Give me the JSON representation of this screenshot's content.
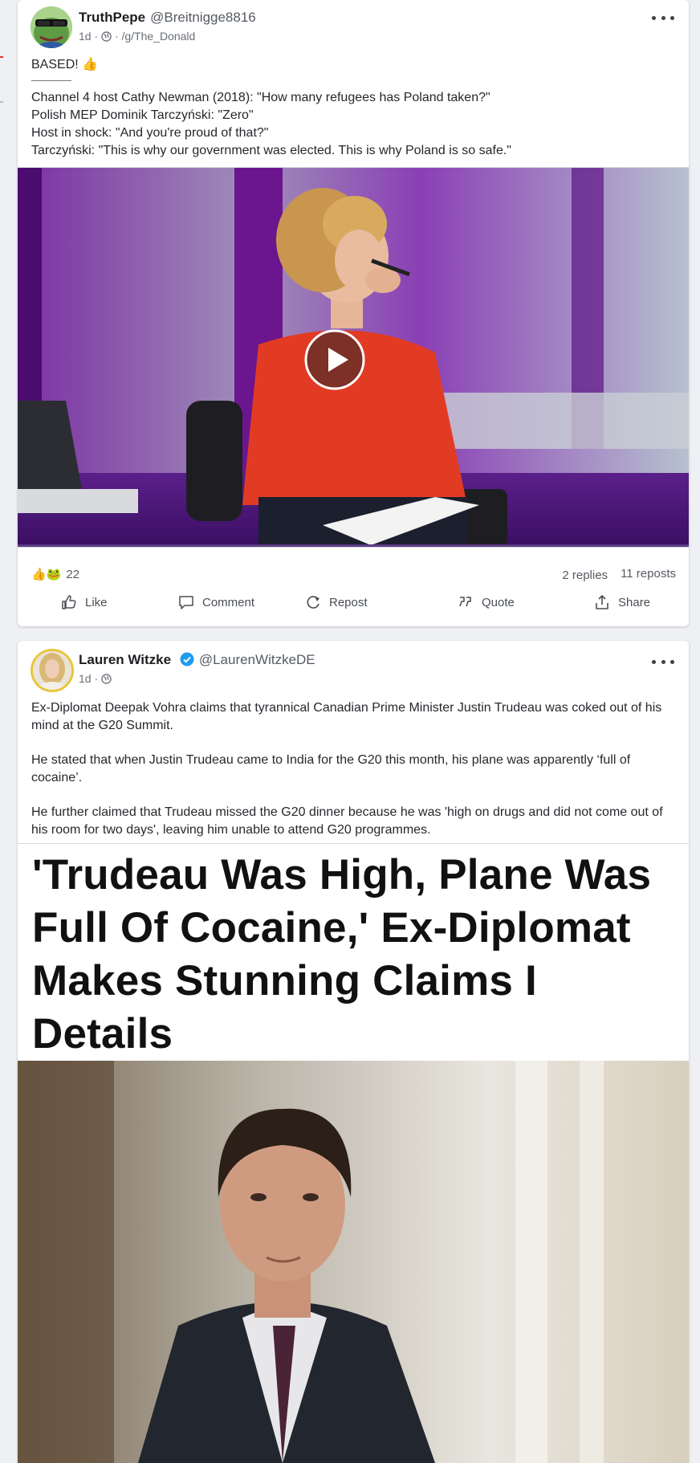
{
  "post1": {
    "author_name": "TruthPepe",
    "author_handle": "@Breitnigge8816",
    "age": "1d",
    "separator": "·",
    "community": "/g/The_Donald",
    "text_lead": "BASED! 👍",
    "text_lines": [
      "Channel 4 host Cathy Newman (2018): \"How many refugees has Poland taken?\"",
      "Polish MEP Dominik Tarczyński: \"Zero\"",
      "Host in shock: \"And you're proud of that?\"",
      "Tarczyński: \"This is why our government was elected. This is why Poland is so safe.\""
    ],
    "reaction_emojis": "👍🐸",
    "reaction_count": "22",
    "replies": "2 replies",
    "reposts": "11 reposts",
    "actions": {
      "like": "Like",
      "comment": "Comment",
      "repost": "Repost",
      "quote": "Quote",
      "share": "Share"
    }
  },
  "post2": {
    "author_name": "Lauren Witzke",
    "author_handle": "@LaurenWitzkeDE",
    "age": "1d",
    "separator": "·",
    "paragraphs": [
      "Ex-Diplomat Deepak Vohra claims that tyrannical Canadian Prime Minister Justin Trudeau was coked out of his mind at the G20 Summit.",
      "He stated that when Justin Trudeau came to India for the G20 this month, his plane was apparently ‘full of cocaine’.",
      "He further claimed that Trudeau missed the G20 dinner because he was 'high on drugs and did not come out of his room for two days', leaving him unable to attend G20 programmes."
    ],
    "headline_image_text": "'Trudeau Was High, Plane Was Full Of Cocaine,' Ex-Diplomat Makes Stunning Claims I Details"
  },
  "colors": {
    "background": "#eef0f3",
    "card": "#ffffff",
    "verified_blue": "#1d9bf0",
    "avatar_ring": "#e8c43a",
    "studio_purple": "#6a1d8f",
    "host_shirt_red": "#e23b24"
  },
  "icons": {
    "more": "ellipsis-icon",
    "globe": "globe-icon",
    "like": "thumbs-up-icon",
    "comment": "comment-bubble-icon",
    "repost": "repost-arrow-icon",
    "quote": "quote-marks-icon",
    "share": "share-upload-icon",
    "play": "play-icon",
    "verified": "verified-badge-icon"
  }
}
